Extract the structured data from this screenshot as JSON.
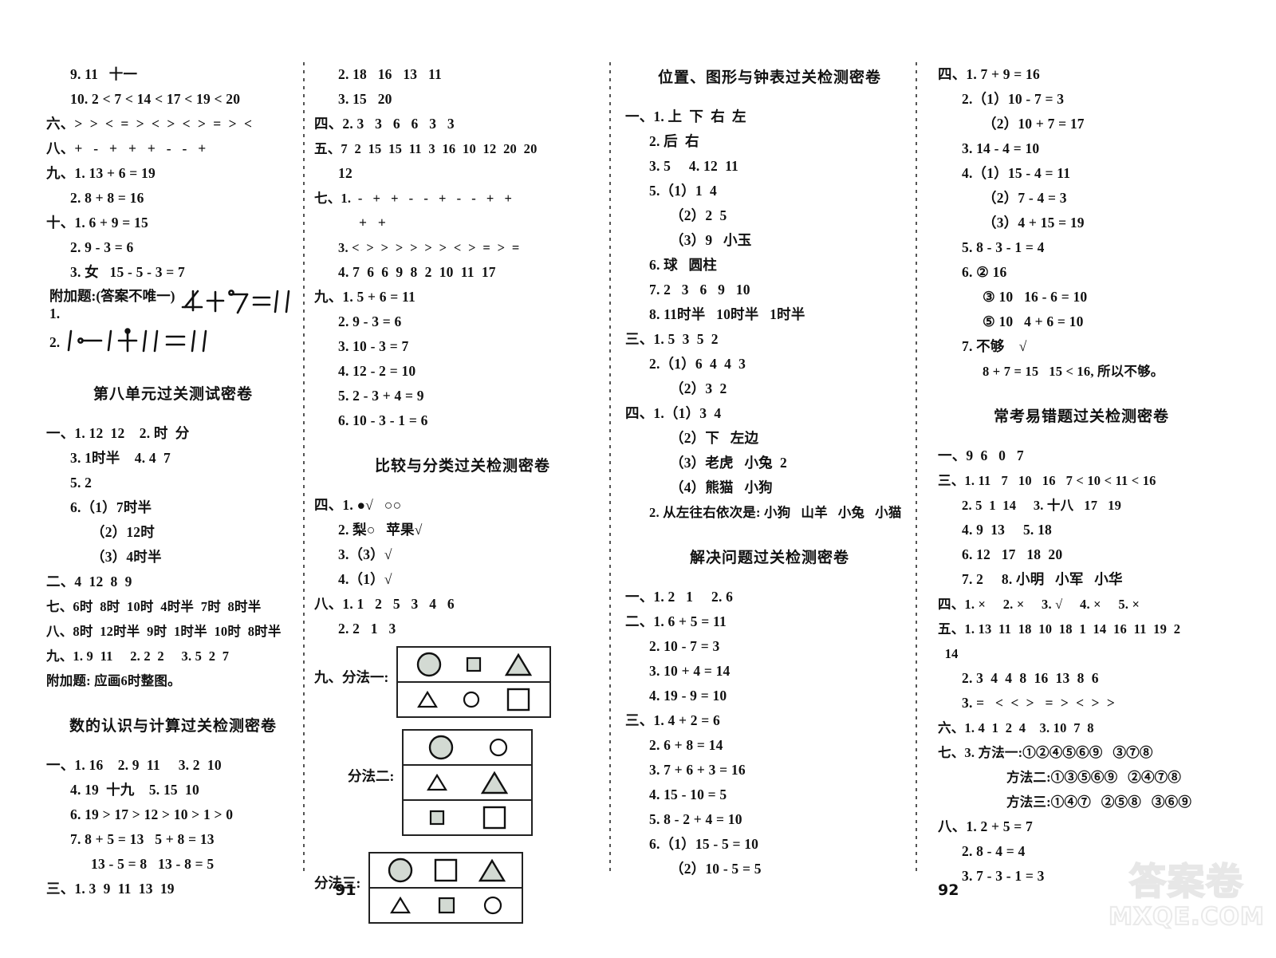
{
  "document": {
    "kind": "scanned-answer-key",
    "page_numbers": {
      "left": "91",
      "right": "92"
    }
  },
  "watermark": {
    "chinese": "答案卷",
    "latin": "MXQE.COM"
  },
  "columns": [
    {
      "id": "column-1",
      "blocks": [
        {
          "type": "lines",
          "lines": [
            {
              "indent": 1,
              "text": "9. 11   十一"
            },
            {
              "indent": 1,
              "text": "10. 2 < 7 < 14 < 17 < 19 < 20"
            },
            {
              "indent": 0,
              "text": "六、>  >  <  =  >  <  >  <  >  =  >  <"
            },
            {
              "indent": 0,
              "text": "八、+   -   +   +   +   -   -   +"
            },
            {
              "indent": 0,
              "text": "九、1. 13 + 6 = 19"
            },
            {
              "indent": 1,
              "text": "2. 8 + 8 = 16"
            },
            {
              "indent": 0,
              "text": "十、1. 6 + 9 = 15"
            },
            {
              "indent": 1,
              "text": "2. 9 - 3 = 6"
            },
            {
              "indent": 1,
              "text": "3. 女   15 - 5 - 3 = 7"
            }
          ]
        },
        {
          "type": "handwriting",
          "prefix": "附加题:(答案不唯一) 1.",
          "item1": "4+7=11",
          "item2_label": "2.",
          "item2": "1-1+11=11"
        },
        {
          "type": "section",
          "title": "第八单元过关测试密卷",
          "lines": [
            {
              "indent": 0,
              "text": "一、1. 12  12    2. 时  分"
            },
            {
              "indent": 1,
              "text": "3. 1时半    4. 4  7"
            },
            {
              "indent": 1,
              "text": "5. 2"
            },
            {
              "indent": 1,
              "text": "6.（1）7时半"
            },
            {
              "indent": 2,
              "text": "（2）12时"
            },
            {
              "indent": 2,
              "text": "（3）4时半"
            },
            {
              "indent": 0,
              "text": "二、4  12  8  9"
            },
            {
              "indent": 0,
              "text": "七、6时  8时  10时  4时半  7时  8时半"
            },
            {
              "indent": 0,
              "text": "八、8时  12时半  9时  1时半  10时  8时半"
            },
            {
              "indent": 0,
              "text": "九、1. 9  11     2. 2  2     3. 5  2  7"
            },
            {
              "indent": 0,
              "text": "附加题: 应画6时整图。"
            }
          ]
        },
        {
          "type": "section",
          "title": "数的认识与计算过关检测密卷",
          "lines": [
            {
              "indent": 0,
              "text": "一、1. 16    2. 9  11     3. 2  10"
            },
            {
              "indent": 1,
              "text": "4. 19  十九    5. 15  10"
            },
            {
              "indent": 1,
              "text": "6. 19 > 17 > 12 > 10 > 1 > 0"
            },
            {
              "indent": 1,
              "text": "7. 8 + 5 = 13   5 + 8 = 13"
            },
            {
              "indent": 2,
              "text": "13 - 5 = 8   13 - 8 = 5"
            },
            {
              "indent": 0,
              "text": "三、1. 3  9  11  13  19"
            }
          ]
        }
      ]
    },
    {
      "id": "column-2",
      "blocks": [
        {
          "type": "lines",
          "lines": [
            {
              "indent": 1,
              "text": "2. 18   16   13   11"
            },
            {
              "indent": 1,
              "text": "3. 15   20"
            },
            {
              "indent": 0,
              "text": "四、2. 3   3   6   6   3   3"
            },
            {
              "indent": 0,
              "text": "五、7  2  15  15  11  3  16  10  12  20  20"
            },
            {
              "indent": 1,
              "text": "12"
            },
            {
              "indent": 0,
              "text": "七、1.  -   +   +   -   -   +   -   -   +   +"
            },
            {
              "indent": 2,
              "text": "+   +"
            },
            {
              "indent": 1,
              "text": "3. <  >  >  >  >  >  >  <  >  =  >  ="
            },
            {
              "indent": 1,
              "text": "4. 7  6  6  9  8  2  10  11  17"
            },
            {
              "indent": 0,
              "text": "九、1. 5 + 6 = 11"
            },
            {
              "indent": 1,
              "text": "2. 9 - 3 = 6"
            },
            {
              "indent": 1,
              "text": "3. 10 - 3 = 7"
            },
            {
              "indent": 1,
              "text": "4. 12 - 2 = 10"
            },
            {
              "indent": 1,
              "text": "5. 2 - 3 + 4 = 9"
            },
            {
              "indent": 1,
              "text": "6. 10 - 3 - 1 = 6"
            }
          ]
        },
        {
          "type": "section",
          "title": "比较与分类过关检测密卷",
          "lines": [
            {
              "indent": 0,
              "text": "四、1. ●√   ○○"
            },
            {
              "indent": 1,
              "text": "2. 梨○   苹果√"
            },
            {
              "indent": 1,
              "text": "3.（3）√"
            },
            {
              "indent": 1,
              "text": "4.（1）√"
            },
            {
              "indent": 0,
              "text": "八、1. 1   2   5   3   4   6"
            },
            {
              "indent": 1,
              "text": "2. 2   1   3"
            }
          ]
        },
        {
          "type": "diagrams",
          "prefix": "九、",
          "groups": [
            {
              "label": "分法一:",
              "rows": [
                [
                  "circle-filled",
                  "square-small-filled",
                  "triangle-filled"
                ],
                [
                  "triangle-small-open",
                  "circle-small-open",
                  "square-open"
                ]
              ]
            },
            {
              "label": "分法二:",
              "rows": [
                [
                  "circle-filled",
                  "circle-small-open"
                ],
                [
                  "triangle-small-open",
                  "triangle-filled"
                ],
                [
                  "square-small-filled",
                  "square-open"
                ]
              ]
            },
            {
              "label": "分法三:",
              "rows": [
                [
                  "circle-filled",
                  "square-open",
                  "triangle-filled"
                ],
                [
                  "triangle-small-open",
                  "square-small-filled",
                  "circle-small-open"
                ]
              ]
            }
          ]
        }
      ]
    },
    {
      "id": "column-3",
      "blocks": [
        {
          "type": "section",
          "title": "位置、图形与钟表过关检测密卷",
          "lines": [
            {
              "indent": 0,
              "text": "一、1. 上  下  右  左"
            },
            {
              "indent": 1,
              "text": "2. 后  右"
            },
            {
              "indent": 1,
              "text": "3. 5     4. 12  11"
            },
            {
              "indent": 1,
              "text": "5.（1）1  4"
            },
            {
              "indent": 2,
              "text": "（2）2  5"
            },
            {
              "indent": 2,
              "text": "（3）9   小玉"
            },
            {
              "indent": 1,
              "text": "6. 球   圆柱"
            },
            {
              "indent": 1,
              "text": "7. 2   3   6   9   10"
            },
            {
              "indent": 1,
              "text": "8. 11时半   10时半   1时半"
            },
            {
              "indent": 0,
              "text": "三、1. 5  3  5  2"
            },
            {
              "indent": 1,
              "text": "2.（1）6  4  4  3"
            },
            {
              "indent": 2,
              "text": "（2）3  2"
            },
            {
              "indent": 0,
              "text": "四、1.（1）3  4"
            },
            {
              "indent": 2,
              "text": "（2）下   左边"
            },
            {
              "indent": 2,
              "text": "（3）老虎   小兔  2"
            },
            {
              "indent": 2,
              "text": "（4）熊猫   小狗"
            },
            {
              "indent": 1,
              "text": "2. 从左往右依次是: 小狗   山羊   小兔   小猫"
            }
          ]
        },
        {
          "type": "section",
          "title": "解决问题过关检测密卷",
          "lines": [
            {
              "indent": 0,
              "text": "一、1. 2   1     2. 6"
            },
            {
              "indent": 0,
              "text": "二、1. 6 + 5 = 11"
            },
            {
              "indent": 1,
              "text": "2. 10 - 7 = 3"
            },
            {
              "indent": 1,
              "text": "3. 10 + 4 = 14"
            },
            {
              "indent": 1,
              "text": "4. 19 - 9 = 10"
            },
            {
              "indent": 0,
              "text": "三、1. 4 + 2 = 6"
            },
            {
              "indent": 1,
              "text": "2. 6 + 8 = 14"
            },
            {
              "indent": 1,
              "text": "3. 7 + 6 + 3 = 16"
            },
            {
              "indent": 1,
              "text": "4. 15 - 10 = 5"
            },
            {
              "indent": 1,
              "text": "5. 8 - 2 + 4 = 10"
            },
            {
              "indent": 1,
              "text": "6.（1）15 - 5 = 10"
            },
            {
              "indent": 2,
              "text": "（2）10 - 5 = 5"
            }
          ]
        }
      ]
    },
    {
      "id": "column-4",
      "blocks": [
        {
          "type": "lines",
          "lines": [
            {
              "indent": 0,
              "text": "四、1. 7 + 9 = 16"
            },
            {
              "indent": 1,
              "text": "2.（1）10 - 7 = 3"
            },
            {
              "indent": 2,
              "text": "（2）10 + 7 = 17"
            },
            {
              "indent": 1,
              "text": "3. 14 - 4 = 10"
            },
            {
              "indent": 1,
              "text": "4.（1）15 - 4 = 11"
            },
            {
              "indent": 2,
              "text": "（2）7 - 4 = 3"
            },
            {
              "indent": 2,
              "text": "（3）4 + 15 = 19"
            },
            {
              "indent": 1,
              "text": "5. 8 - 3 - 1 = 4"
            },
            {
              "indent": 1,
              "text": "6. ② 16"
            },
            {
              "indent": 2,
              "text": "③ 10   16 - 6 = 10"
            },
            {
              "indent": 2,
              "text": "⑤ 10   4 + 6 = 10"
            },
            {
              "indent": 1,
              "text": "7. 不够    √"
            },
            {
              "indent": 2,
              "text": "8 + 7 = 15   15 < 16, 所以不够。"
            }
          ]
        },
        {
          "type": "section",
          "title": "常考易错题过关检测密卷",
          "lines": [
            {
              "indent": 0,
              "text": "一、9  6   0   7"
            },
            {
              "indent": 0,
              "text": "三、1. 11   7   10   16   7 < 10 < 11 < 16"
            },
            {
              "indent": 1,
              "text": "2. 5  1  14     3. 十八   17   19"
            },
            {
              "indent": 1,
              "text": "4. 9  13     5. 18"
            },
            {
              "indent": 1,
              "text": "6. 12   17   18  20"
            },
            {
              "indent": 1,
              "text": "7. 2     8. 小明   小军   小华"
            },
            {
              "indent": 0,
              "text": "四、1. ×     2. ×     3. √     4. ×     5. ×"
            },
            {
              "indent": 0,
              "text": "五、1. 13  11  18  10  18  1  14  16  11  19  2"
            },
            {
              "indent": 0,
              "text": "  14"
            },
            {
              "indent": 1,
              "text": "2. 3  4  4  8  16  13  8  6"
            },
            {
              "indent": 1,
              "text": "3. =   <  <  >   =  >  <  >  >"
            },
            {
              "indent": 0,
              "text": "六、1. 4  1  2  4    3. 10  7  8"
            },
            {
              "indent": 0,
              "text": "七、3. 方法一:①②④⑤⑥⑨   ③⑦⑧"
            },
            {
              "indent": 3,
              "text": "方法二:①③⑤⑥⑨   ②④⑦⑧"
            },
            {
              "indent": 3,
              "text": "方法三:①④⑦   ②⑤⑧   ③⑥⑨"
            },
            {
              "indent": 0,
              "text": "八、1. 2 + 5 = 7"
            },
            {
              "indent": 1,
              "text": "2. 8 - 4 = 4"
            },
            {
              "indent": 1,
              "text": "3. 7 - 3 - 1 = 3"
            }
          ]
        }
      ]
    }
  ]
}
